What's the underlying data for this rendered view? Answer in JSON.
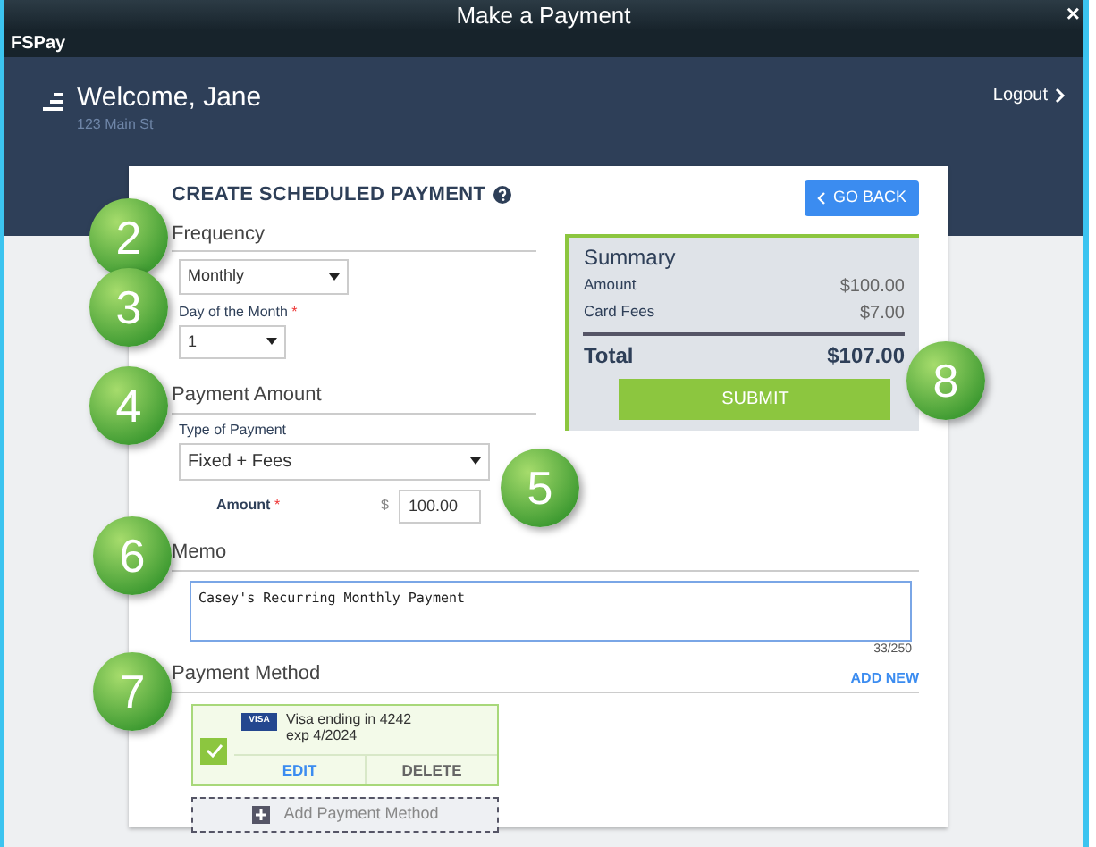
{
  "window": {
    "title": "Make a Payment",
    "close": "×"
  },
  "app_bar": {
    "name": "FSPay"
  },
  "header": {
    "welcome": "Welcome, Jane",
    "address": "123 Main St",
    "logout": "Logout"
  },
  "form": {
    "title": "CREATE SCHEDULED PAYMENT",
    "back": "GO BACK",
    "frequency": {
      "heading": "Frequency",
      "value": "Monthly"
    },
    "day": {
      "label": "Day of the Month",
      "required_mark": "*",
      "value": "1"
    },
    "amount_section": {
      "heading": "Payment Amount",
      "type_label": "Type of Payment",
      "type_value": "Fixed + Fees",
      "amount_label": "Amount",
      "required_mark": "*",
      "currency": "$",
      "amount_value": "100.00"
    },
    "memo": {
      "heading": "Memo",
      "value": "Casey's Recurring Monthly Payment",
      "counter": "33/250"
    },
    "payment_method": {
      "heading": "Payment Method",
      "add_new": "ADD NEW",
      "cards": [
        {
          "brand": "VISA",
          "line1": "Visa ending in 4242",
          "line2": "exp 4/2024",
          "checked": true,
          "edit": "EDIT",
          "delete": "DELETE"
        }
      ],
      "add_button": "Add Payment Method"
    }
  },
  "summary": {
    "title": "Summary",
    "rows": [
      {
        "label": "Amount",
        "value": "$100.00"
      },
      {
        "label": "Card Fees",
        "value": "$7.00"
      }
    ],
    "total_label": "Total",
    "total_value": "$107.00",
    "submit": "SUBMIT"
  },
  "callouts": [
    {
      "number": "2"
    },
    {
      "number": "3"
    },
    {
      "number": "4"
    },
    {
      "number": "5"
    },
    {
      "number": "6"
    },
    {
      "number": "7"
    },
    {
      "number": "8"
    }
  ]
}
